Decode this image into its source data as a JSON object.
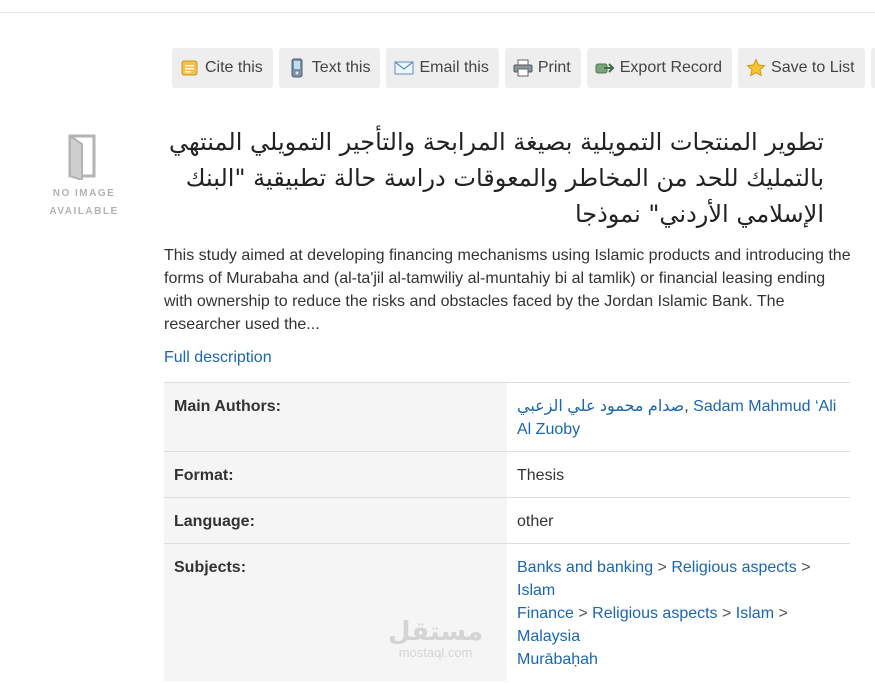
{
  "toolbar": {
    "cite": "Cite this",
    "text": "Text this",
    "email": "Email this",
    "print": "Print",
    "export": "Export Record",
    "save": "Save to List"
  },
  "no_image": {
    "line1": "NO IMAGE",
    "line2": "AVAILABLE"
  },
  "record": {
    "title": "تطوير المنتجات التمويلية بصيغة المرابحة والتأجير التمويلي المنتهي بالتمليك للحد من المخاطر والمعوقات دراسة حالة تطبيقية \"البنك الإسلامي الأردني\" نموذجا",
    "summary": "This study aimed at developing financing mechanisms using Islamic products and introducing the forms of Murabaha and (al-ta'jil al-tamwiliy al-muntahiy bi al tamlik) or financial leasing ending with ownership to reduce the risks and obstacles faced by the Jordan Islamic Bank. The researcher used the...",
    "full_description": "Full description"
  },
  "details": {
    "authors_label": "Main Authors:",
    "author_ar": "صدام محمود علي الزعبي",
    "author_comma": ", ",
    "author_en": "Sadam Mahmud ‘Ali Al Zuoby",
    "format_label": "Format:",
    "format_value": "Thesis",
    "language_label": "Language:",
    "language_value": "other",
    "subjects_label": "Subjects:",
    "sep": " > ",
    "subject1": [
      "Banks and banking",
      "Religious aspects",
      "Islam"
    ],
    "subject2": [
      "Finance",
      "Religious aspects",
      "Islam",
      "Malaysia"
    ],
    "subject3": "Murābaḥah"
  },
  "watermark": {
    "arabic": "مستقل",
    "latin": "mostaql.com"
  },
  "colors": {
    "link": "#1a66b3",
    "button_bg": "#eeeeee",
    "label_bg": "#f5f5f5"
  }
}
